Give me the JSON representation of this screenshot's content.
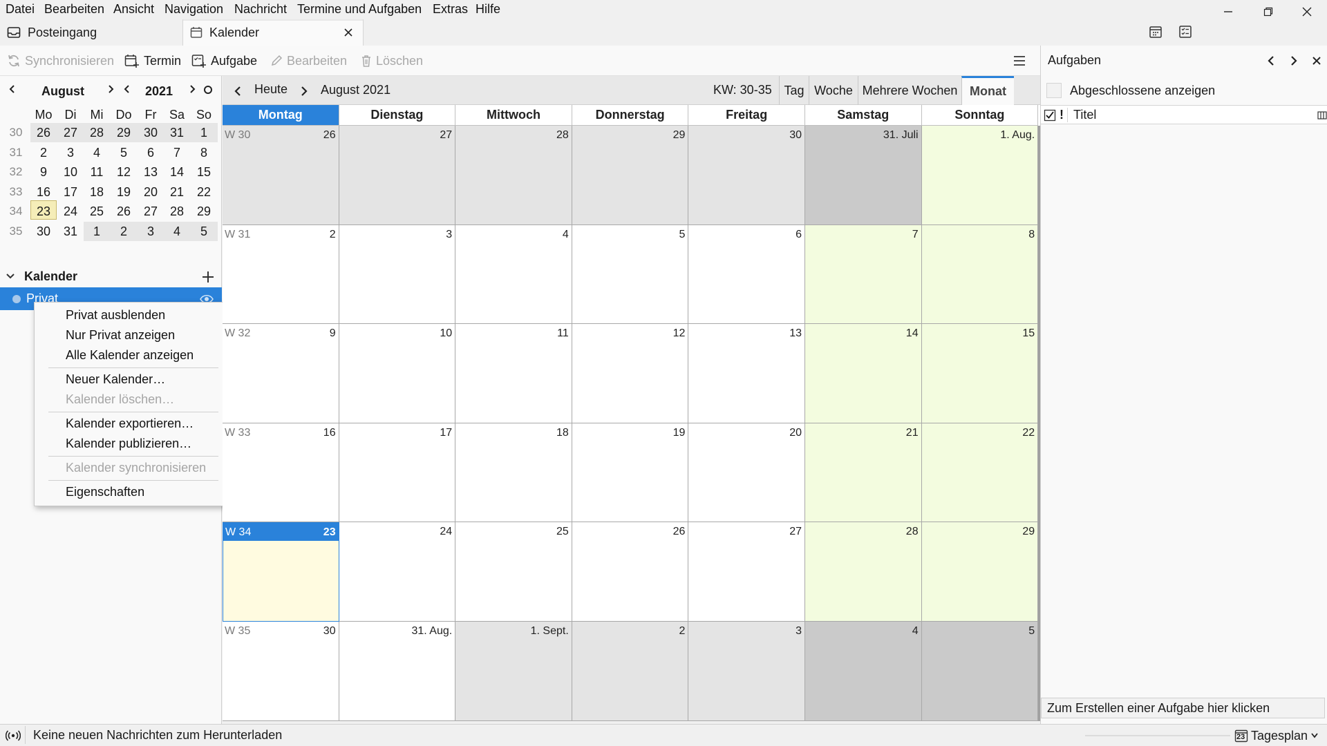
{
  "menubar": {
    "items": [
      "Datei",
      "Bearbeiten",
      "Ansicht",
      "Navigation",
      "Nachricht",
      "Termine und Aufgaben",
      "Extras",
      "Hilfe"
    ]
  },
  "tabs": {
    "inbox": "Posteingang",
    "calendar": "Kalender"
  },
  "toolbar": {
    "sync": "Synchronisieren",
    "event": "Termin",
    "task": "Aufgabe",
    "edit": "Bearbeiten",
    "delete": "Löschen"
  },
  "minical": {
    "month": "August",
    "year": "2021",
    "weekdays": [
      "Mo",
      "Di",
      "Mi",
      "Do",
      "Fr",
      "Sa",
      "So"
    ],
    "weeks": [
      {
        "wk": "30",
        "days": [
          "26",
          "27",
          "28",
          "29",
          "30",
          "31",
          "1"
        ]
      },
      {
        "wk": "31",
        "days": [
          "2",
          "3",
          "4",
          "5",
          "6",
          "7",
          "8"
        ]
      },
      {
        "wk": "32",
        "days": [
          "9",
          "10",
          "11",
          "12",
          "13",
          "14",
          "15"
        ]
      },
      {
        "wk": "33",
        "days": [
          "16",
          "17",
          "18",
          "19",
          "20",
          "21",
          "22"
        ]
      },
      {
        "wk": "34",
        "days": [
          "23",
          "24",
          "25",
          "26",
          "27",
          "28",
          "29"
        ]
      },
      {
        "wk": "35",
        "days": [
          "30",
          "31",
          "1",
          "2",
          "3",
          "4",
          "5"
        ]
      }
    ],
    "today": "23"
  },
  "calendars": {
    "header": "Kalender",
    "items": [
      {
        "name": "Privat",
        "color": "#a8c8ea"
      }
    ]
  },
  "context_menu": {
    "items": [
      {
        "label": "Privat ausblenden",
        "disabled": false
      },
      {
        "label": "Nur Privat anzeigen",
        "disabled": false
      },
      {
        "label": "Alle Kalender anzeigen",
        "disabled": false
      },
      {
        "label": "Neuer Kalender…",
        "disabled": false
      },
      {
        "label": "Kalender löschen…",
        "disabled": true
      },
      {
        "label": "Kalender exportieren…",
        "disabled": false
      },
      {
        "label": "Kalender publizieren…",
        "disabled": false
      },
      {
        "label": "Kalender synchronisieren",
        "disabled": true
      },
      {
        "label": "Eigenschaften",
        "disabled": false
      }
    ]
  },
  "calnav": {
    "today": "Heute",
    "period": "August 2021",
    "kw": "KW: 30-35",
    "views": [
      "Tag",
      "Woche",
      "Mehrere Wochen",
      "Monat"
    ],
    "active_view": "Monat"
  },
  "month": {
    "day_headers": [
      "Montag",
      "Dienstag",
      "Mittwoch",
      "Donnerstag",
      "Freitag",
      "Samstag",
      "Sonntag"
    ],
    "weeks": [
      {
        "wk": "W 30",
        "days": [
          "26",
          "27",
          "28",
          "29",
          "30",
          "31. Juli",
          "1. Aug."
        ]
      },
      {
        "wk": "W 31",
        "days": [
          "2",
          "3",
          "4",
          "5",
          "6",
          "7",
          "8"
        ]
      },
      {
        "wk": "W 32",
        "days": [
          "9",
          "10",
          "11",
          "12",
          "13",
          "14",
          "15"
        ]
      },
      {
        "wk": "W 33",
        "days": [
          "16",
          "17",
          "18",
          "19",
          "20",
          "21",
          "22"
        ]
      },
      {
        "wk": "W 34",
        "days": [
          "23",
          "24",
          "25",
          "26",
          "27",
          "28",
          "29"
        ]
      },
      {
        "wk": "W 35",
        "days": [
          "30",
          "31. Aug.",
          "1. Sept.",
          "2",
          "3",
          "4",
          "5"
        ]
      }
    ]
  },
  "tasks": {
    "title": "Aufgaben",
    "show_completed": "Abgeschlossene anzeigen",
    "col_title": "Titel",
    "priority_col": "!",
    "quick_add": "Zum Erstellen einer Aufgabe hier klicken"
  },
  "statusbar": {
    "message": "Keine neuen Nachrichten zum Herunterladen",
    "today_pane": "Tagesplan",
    "today_pane_day": "23"
  },
  "colors": {
    "accent": "#2a82da",
    "weekend": "#f3fcdf",
    "other_month": "#e4e4e4",
    "other_month_weekend": "#cacaca",
    "today_cell": "#fffbe0"
  }
}
